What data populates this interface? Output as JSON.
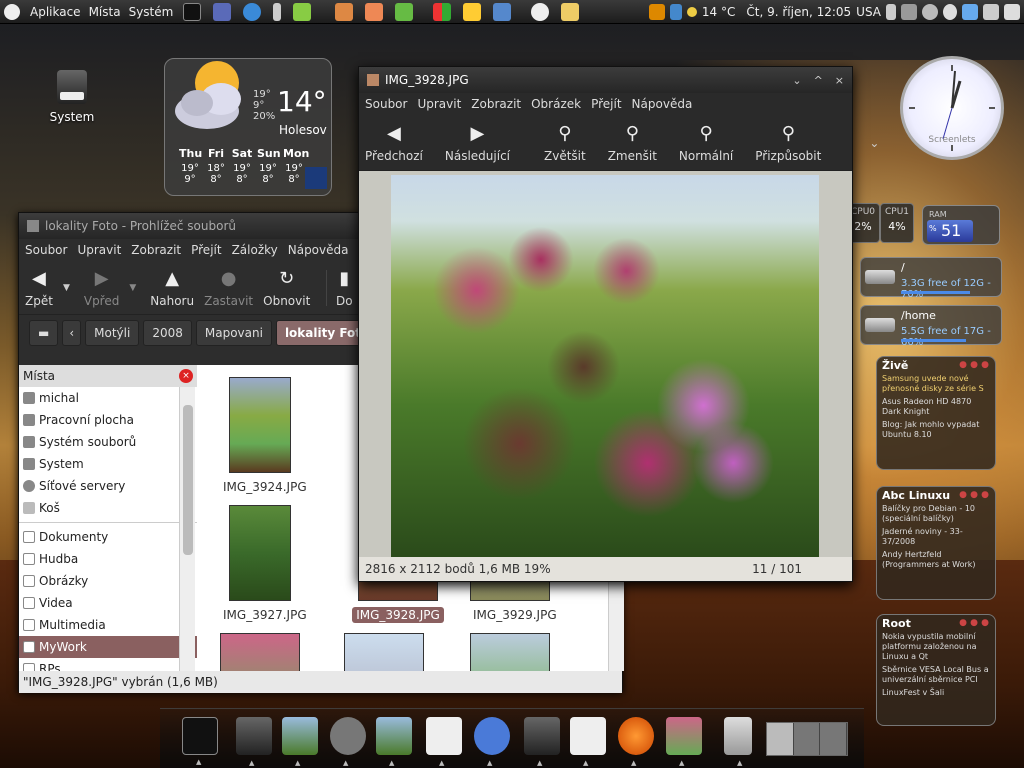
{
  "top_panel": {
    "menus": [
      "Aplikace",
      "Místa",
      "Systém"
    ],
    "temperature": "14 °C",
    "datetime": "Čt, 9. říjen, 12:05",
    "keyboard": "USA"
  },
  "desktop": {
    "system_label": "System"
  },
  "weather": {
    "temp": "14°",
    "city": "Holesov",
    "high": "19°",
    "low": "9°",
    "humidity": "20%",
    "days": [
      "Thu",
      "Fri",
      "Sat",
      "Sun",
      "Mon"
    ],
    "day_high": [
      "19°",
      "18°",
      "19°",
      "19°",
      "19°"
    ],
    "day_low": [
      "9°",
      "8°",
      "8°",
      "8°",
      "8°"
    ],
    "logo": "The Weather Channel"
  },
  "clock": {
    "brand": "Screenlets",
    "hour": 12,
    "minute": 5
  },
  "system_monitor": {
    "cpu0_label": "CPU0",
    "cpu0": "2%",
    "cpu1_label": "CPU1",
    "cpu1": "4%",
    "ram_label": "RAM",
    "ram": "51",
    "ram_pct": "%"
  },
  "disks": [
    {
      "path": "/",
      "free": "3.3G free of 12G - 70%"
    },
    {
      "path": "/home",
      "free": "5.5G free of 17G - 66%"
    }
  ],
  "rss": [
    {
      "title": "Živě",
      "items": [
        "Samsung uvede nové přenosné disky ze série S",
        "Asus Radeon HD 4870 Dark Knight",
        "Blog: Jak mohlo vypadat Ubuntu 8.10"
      ]
    },
    {
      "title": "Abc Linuxu",
      "items": [
        "Balíčky pro Debian - 10 (speciální balíčky)",
        "Jaderné noviny - 33-37/2008",
        "Andy Hertzfeld (Programmers at Work)"
      ]
    },
    {
      "title": "Root",
      "items": [
        "Nokia vypustila mobilní platformu založenou na Linuxu a Qt",
        "Sběrnice VESA Local Bus a univerzální sběrnice PCI",
        "LinuxFest v Šali"
      ]
    }
  ],
  "file_manager": {
    "title": "lokality Foto - Prohlížeč souborů",
    "menu": [
      "Soubor",
      "Upravit",
      "Zobrazit",
      "Přejít",
      "Záložky",
      "Nápověda"
    ],
    "toolbar": {
      "back": "Zpět",
      "forward": "Vpřed",
      "up": "Nahoru",
      "stop": "Zastavit",
      "reload": "Obnovit",
      "home": "Do"
    },
    "breadcrumbs": [
      "Motýli",
      "2008",
      "Mapovani",
      "lokality Foto"
    ],
    "sidebar_header": "Místa",
    "places": [
      "michal",
      "Pracovní plocha",
      "Systém souborů",
      "System",
      "Síťové servery",
      "Koš"
    ],
    "bookmarks": [
      "Dokumenty",
      "Hudba",
      "Obrázky",
      "Videa",
      "Multimedia",
      "MyWork",
      "RPs"
    ],
    "files": [
      "IMG_3924.JPG",
      "IM",
      "IMG_3927.JPG",
      "IMG_3928.JPG",
      "IMG_3929.JPG"
    ],
    "status": "\"IMG_3928.JPG\" vybrán (1,6 MB)"
  },
  "image_viewer": {
    "title": "IMG_3928.JPG",
    "menu": [
      "Soubor",
      "Upravit",
      "Zobrazit",
      "Obrázek",
      "Přejít",
      "Nápověda"
    ],
    "toolbar": [
      "Předchozí",
      "Následující",
      "Zvětšit",
      "Zmenšit",
      "Normální",
      "Přizpůsobit"
    ],
    "info": "2816 x 2112 bodů  1,6 MB    19%",
    "page": "11 / 101"
  },
  "colors": {
    "selection": "#8a6060",
    "panel": "#2a2a2a",
    "accent": "#4a8ae8"
  }
}
